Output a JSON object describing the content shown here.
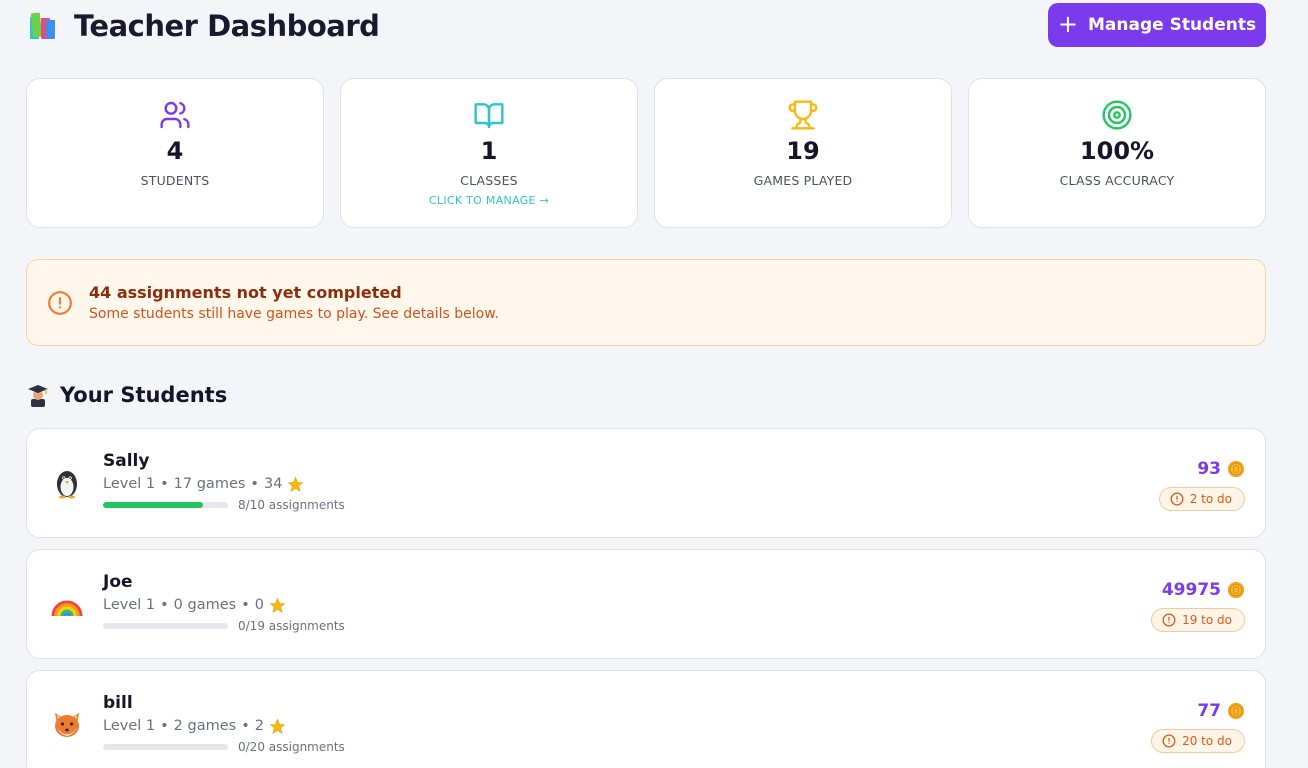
{
  "header": {
    "title": "Teacher Dashboard",
    "manage_button": "Manage Students"
  },
  "stats": [
    {
      "value": "4",
      "label": "STUDENTS",
      "icon": "users-icon"
    },
    {
      "value": "1",
      "label": "CLASSES",
      "sub": "CLICK TO MANAGE →",
      "icon": "book-open-icon"
    },
    {
      "value": "19",
      "label": "GAMES PLAYED",
      "icon": "trophy-icon"
    },
    {
      "value": "100%",
      "label": "CLASS ACCURACY",
      "icon": "target-icon"
    }
  ],
  "alert": {
    "title": "44 assignments not yet completed",
    "text": "Some students still have games to play. See details below."
  },
  "students_section": {
    "title": "Your Students"
  },
  "students": [
    {
      "name": "Sally",
      "level": "Level 1",
      "games": "17 games",
      "stars": "34",
      "assignments": "8/10 assignments",
      "progress": 0.8,
      "coins": "93",
      "todo": "2 to do",
      "avatar": "penguin-icon"
    },
    {
      "name": "Joe",
      "level": "Level 1",
      "games": "0 games",
      "stars": "0",
      "assignments": "0/19 assignments",
      "progress": 0,
      "coins": "49975",
      "todo": "19 to do",
      "avatar": "rainbow-icon"
    },
    {
      "name": "bill",
      "level": "Level 1",
      "games": "2 games",
      "stars": "2",
      "assignments": "0/20 assignments",
      "progress": 0,
      "coins": "77",
      "todo": "20 to do",
      "avatar": "fox-icon"
    }
  ],
  "colors": {
    "accent": "#7c3aed",
    "progress": "#22c55e",
    "warning": "#dd5a16",
    "teal": "#2ec4c9",
    "gold": "#f5b912",
    "green": "#22c55e"
  }
}
